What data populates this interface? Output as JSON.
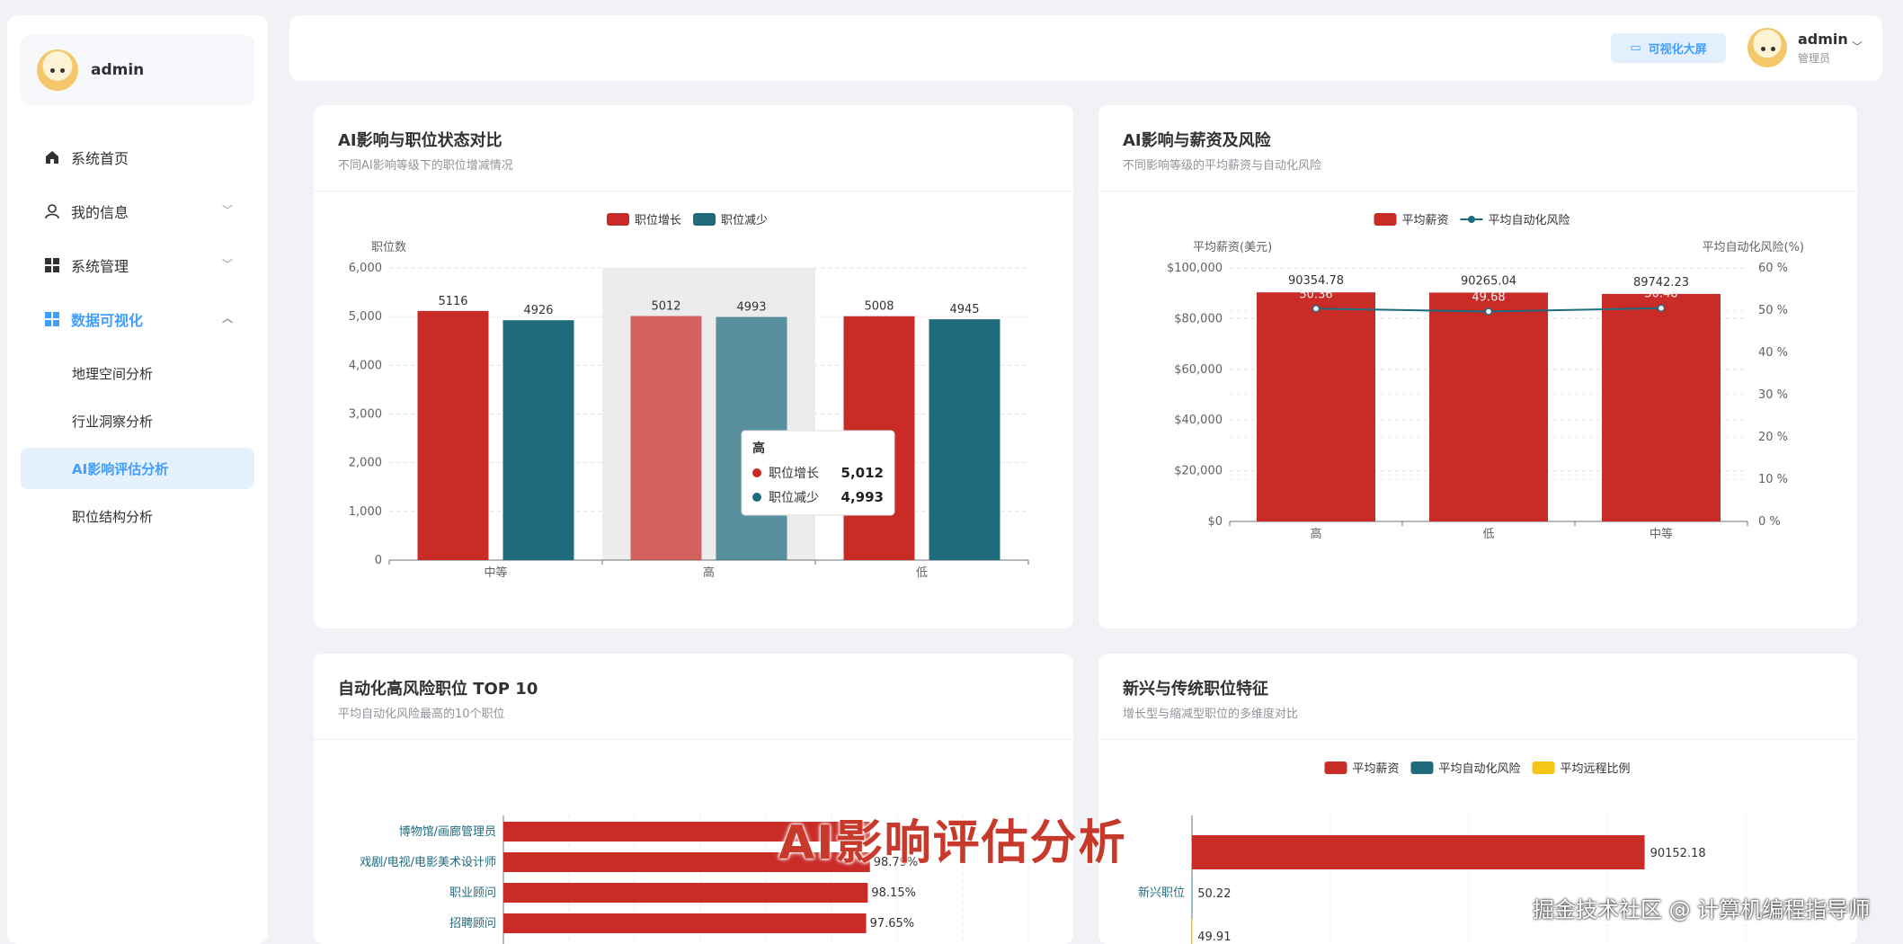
{
  "sidebar": {
    "username": "admin",
    "menu": [
      {
        "label": "系统首页",
        "icon": "home-icon"
      },
      {
        "label": "我的信息",
        "icon": "user-icon"
      },
      {
        "label": "系统管理",
        "icon": "grid-icon"
      },
      {
        "label": "数据可视化",
        "icon": "grid-icon"
      }
    ],
    "submenu": [
      "地理空间分析",
      "行业洞察分析",
      "AI影响评估分析",
      "职位结构分析"
    ]
  },
  "header": {
    "viz_button": "可视化大屏",
    "username": "admin",
    "role": "管理员"
  },
  "cards": {
    "c1": {
      "title": "AI影响与职位状态对比",
      "subtitle": "不同AI影响等级下的职位增减情况"
    },
    "c2": {
      "title": "AI影响与薪资及风险",
      "subtitle": "不同影响等级的平均薪资与自动化风险"
    },
    "c3": {
      "title": "自动化高风险职位 TOP 10",
      "subtitle": "平均自动化风险最高的10个职位"
    },
    "c4": {
      "title": "新兴与传统职位特征",
      "subtitle": "增长型与缩减型职位的多维度对比"
    }
  },
  "overlay_title": "AI影响评估分析",
  "watermark": "掘金技术社区 @ 计算机编程指导师",
  "colors": {
    "red": "#c92b27",
    "teal": "#1f6b7e",
    "yellow": "#f5c518",
    "accent": "#409eff"
  },
  "chart_data": [
    {
      "type": "bar",
      "ylabel": "职位数",
      "ylim": [
        0,
        6000
      ],
      "yticks": [
        "0",
        "1,000",
        "2,000",
        "3,000",
        "4,000",
        "5,000",
        "6,000"
      ],
      "categories": [
        "中等",
        "高",
        "低"
      ],
      "highlighted_category": "高",
      "series": [
        {
          "name": "职位增长",
          "values": [
            5116,
            5012,
            5008
          ],
          "labels": [
            "5116",
            "5012",
            "5008"
          ]
        },
        {
          "name": "职位减少",
          "values": [
            4926,
            4993,
            4945
          ],
          "labels": [
            "4926",
            "4993",
            "4945"
          ]
        }
      ],
      "tooltip": {
        "title": "高",
        "rows": [
          {
            "name": "职位增长",
            "value": "5,012"
          },
          {
            "name": "职位减少",
            "value": "4,993"
          }
        ]
      }
    },
    {
      "type": "bar",
      "ylabel": "平均薪资(美元)",
      "y2label": "平均自动化风险(%)",
      "ylim": [
        0,
        100000
      ],
      "y2lim": [
        0,
        60
      ],
      "yticks": [
        "$0",
        "$20,000",
        "$40,000",
        "$60,000",
        "$80,000",
        "$100,000"
      ],
      "y2ticks": [
        "0 %",
        "10 %",
        "20 %",
        "30 %",
        "40 %",
        "50 %",
        "60 %"
      ],
      "categories": [
        "高",
        "低",
        "中等"
      ],
      "series": [
        {
          "name": "平均薪资",
          "type": "bar",
          "values": [
            90354.78,
            90265.04,
            89742.23
          ],
          "labels": [
            "90354.78",
            "90265.04",
            "89742.23"
          ]
        },
        {
          "name": "平均自动化风险",
          "type": "line",
          "values": [
            50.36,
            49.68,
            50.48
          ],
          "labels": [
            "50.36",
            "49.68",
            "50.48"
          ]
        }
      ]
    },
    {
      "type": "bar",
      "orientation": "horizontal",
      "categories": [
        "博物馆/画廊管理员",
        "戏剧/电视/电影美术设计师",
        "职业顾问",
        "招聘顾问"
      ],
      "values": [
        98.79,
        98.79,
        98.15,
        97.65
      ],
      "labels": [
        "",
        "98.79%",
        "98.15%",
        "97.65%"
      ]
    },
    {
      "type": "bar",
      "orientation": "horizontal",
      "legend": [
        "平均薪资",
        "平均自动化风险",
        "平均远程比例"
      ],
      "categories": [
        "新兴职位"
      ],
      "series": [
        {
          "name": "平均薪资",
          "values": [
            90152.18
          ],
          "labels": [
            "90152.18"
          ]
        },
        {
          "name": "平均自动化风险",
          "values": [
            50.22
          ],
          "labels": [
            "50.22"
          ]
        },
        {
          "name": "平均远程比例",
          "values": [
            49.91
          ],
          "labels": [
            "49.91"
          ]
        }
      ]
    }
  ]
}
